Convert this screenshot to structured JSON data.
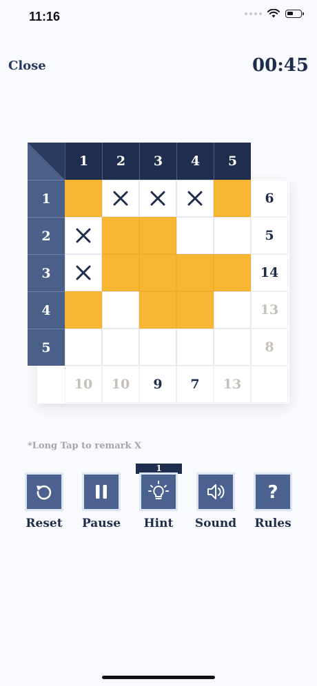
{
  "status_bar": {
    "time": "11:16"
  },
  "header": {
    "close_label": "Close",
    "timer": "00:45"
  },
  "board": {
    "column_headers": [
      "1",
      "2",
      "3",
      "4",
      "5"
    ],
    "row_headers": [
      "1",
      "2",
      "3",
      "4",
      "5"
    ],
    "cells": [
      [
        "filled",
        "x",
        "x",
        "x",
        "filled"
      ],
      [
        "x",
        "filled",
        "filled",
        "empty",
        "empty"
      ],
      [
        "x",
        "filled",
        "filled",
        "filled",
        "filled"
      ],
      [
        "filled",
        "empty",
        "filled",
        "filled",
        "empty"
      ],
      [
        "empty",
        "empty",
        "empty",
        "empty",
        "empty"
      ]
    ],
    "row_clues": [
      {
        "value": "6",
        "state": "todo"
      },
      {
        "value": "5",
        "state": "todo"
      },
      {
        "value": "14",
        "state": "todo"
      },
      {
        "value": "13",
        "state": "done"
      },
      {
        "value": "8",
        "state": "done"
      }
    ],
    "column_clues": [
      {
        "value": "10",
        "state": "done"
      },
      {
        "value": "10",
        "state": "done"
      },
      {
        "value": "9",
        "state": "todo"
      },
      {
        "value": "7",
        "state": "todo"
      },
      {
        "value": "13",
        "state": "done"
      }
    ],
    "colors": {
      "filled": "#f8b733",
      "header_dark": "#1f2e4e",
      "header_row": "#4a6088",
      "done_clue": "#c5c0b8"
    }
  },
  "note": "*Long Tap to remark X",
  "controls": {
    "hint_count": "1",
    "reset": {
      "label": "Reset",
      "icon": "reset-icon"
    },
    "pause": {
      "label": "Pause",
      "icon": "pause-icon"
    },
    "hint": {
      "label": "Hint",
      "icon": "lightbulb-icon"
    },
    "sound": {
      "label": "Sound",
      "icon": "speaker-icon"
    },
    "rules": {
      "label": "Rules",
      "icon": "question-icon"
    }
  }
}
